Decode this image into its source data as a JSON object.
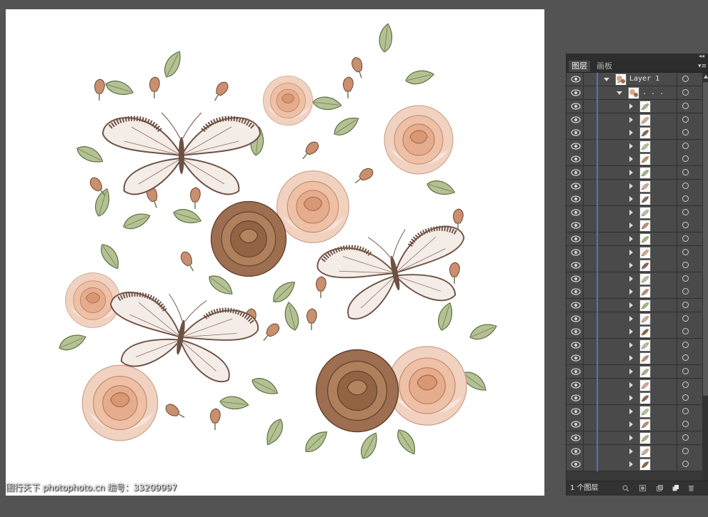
{
  "panel": {
    "tabs": [
      {
        "label": "图层",
        "active": true
      },
      {
        "label": "画板",
        "active": false
      }
    ],
    "layer_name": "Layer 1",
    "group_name": ". . .",
    "sublayer_count_visible": 28,
    "layer_count_label": "1 个图层",
    "accent_color": "#4f73c9",
    "icons": {
      "collapse": "double-chevron-icon",
      "menu": "panel-menu-icon",
      "visibility": "eye-icon",
      "target": "target-circle-icon",
      "locate": "locate-object-icon",
      "clipping": "make-clipping-mask-icon",
      "sublayer": "create-sublayer-icon",
      "new_layer": "new-layer-icon",
      "delete": "trash-icon"
    }
  },
  "canvas": {
    "watermark": "图行天下 photophoto.cn  编号：33209997",
    "colors": {
      "rose_light": "#f1cdb9",
      "rose_dark": "#8f6446",
      "leaf": "#aebd8e",
      "butterfly": "#6e5145"
    }
  }
}
